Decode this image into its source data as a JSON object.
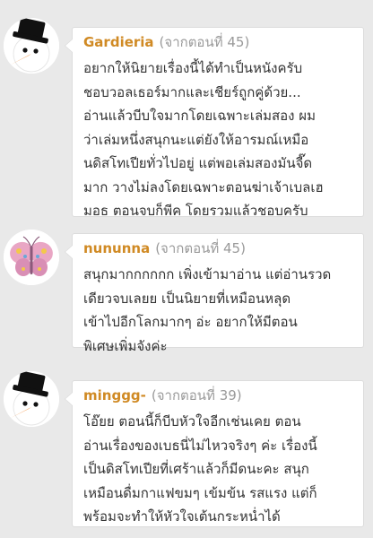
{
  "comments": [
    {
      "avatar": "snowman-icon",
      "author": "Gardieria",
      "source": "(จากตอนที่ 45)",
      "text": "อยากให้นิยายเรื่องนี้ได้ทำเป็นหนังครับ\nชอบวอลเธอร์มากและเชียร์ถูกคู่ด้วย...\nอ่านแล้วบีบใจมากโดยเฉพาะเล่มสอง ผม\nว่าเล่มหนึ่งสนุกนะแต่ยังให้อารมณ์เหมือ\nนดิสโทเปียทั่วไปอยู่ แต่พอเล่มสองมันจี๊ด\nมาก วางไม่ลงโดยเฉพาะตอนฆ่าเจ้าเบลเฮ\nมอธ ตอนจบก็พีค โดยรวมแล้วชอบครับ"
    },
    {
      "avatar": "butterfly-icon",
      "author": "nununna",
      "source": "(จากตอนที่ 45)",
      "text": "สนุกมากกกกกก เพิ่งเข้ามาอ่าน แต่อ่านรวด\nเดียวจบเลยย เป็นนิยายที่เหมือนหลุด\nเข้าไปอีกโลกมากๆ อ่ะ อยากให้มีตอน\nพิเศษเพิ่มจังค่ะ"
    },
    {
      "avatar": "snowman-icon",
      "author": "minggg-",
      "source": "(จากตอนที่ 39)",
      "text": "โอ๊ยย ตอนนี้ก็บีบหัวใจอีกเช่นเคย ตอน\nอ่านเรื่องของเบธนี่ไม่ไหวจริงๆ ค่ะ เรื่องนี้\nเป็นดิสโทเปียที่เศร้าแล้วก็มีดนะคะ สนุก\nเหมือนดื่มกาแฟขมๆ เข้มข้น รสแรง แต่ก็\nพร้อมจะทำให้หัวใจเต้นกระหน่ำได้"
    }
  ],
  "colors": {
    "background": "#e9e9e9",
    "author": "#d08a24",
    "source": "#9a9a9a",
    "text": "#333333"
  }
}
